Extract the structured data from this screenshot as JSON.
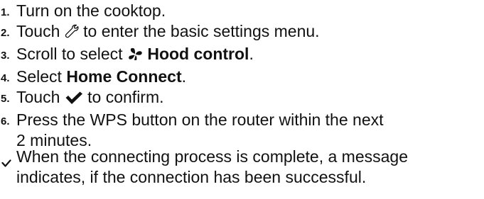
{
  "steps": [
    {
      "number": "1.",
      "text": "Turn on the cooktop."
    },
    {
      "number": "2.",
      "before": "Touch",
      "icon": "wrench-icon",
      "after": "to enter the basic settings menu."
    },
    {
      "number": "3.",
      "before": "Scroll to select",
      "icon": "fan-icon",
      "bold": "Hood control",
      "after": "."
    },
    {
      "number": "4.",
      "before": "Select",
      "bold": "Home Connect",
      "after": "."
    },
    {
      "number": "5.",
      "before": "Touch",
      "icon": "checkmark-icon",
      "after": "to confirm."
    },
    {
      "number": "6.",
      "line1": "Press the WPS button on the router within the next",
      "line2": "2 minutes."
    }
  ],
  "result": {
    "icon": "result-check-icon",
    "line1": "When the connecting process is complete, a message",
    "line2": "indicates, if the connection has been successful."
  }
}
